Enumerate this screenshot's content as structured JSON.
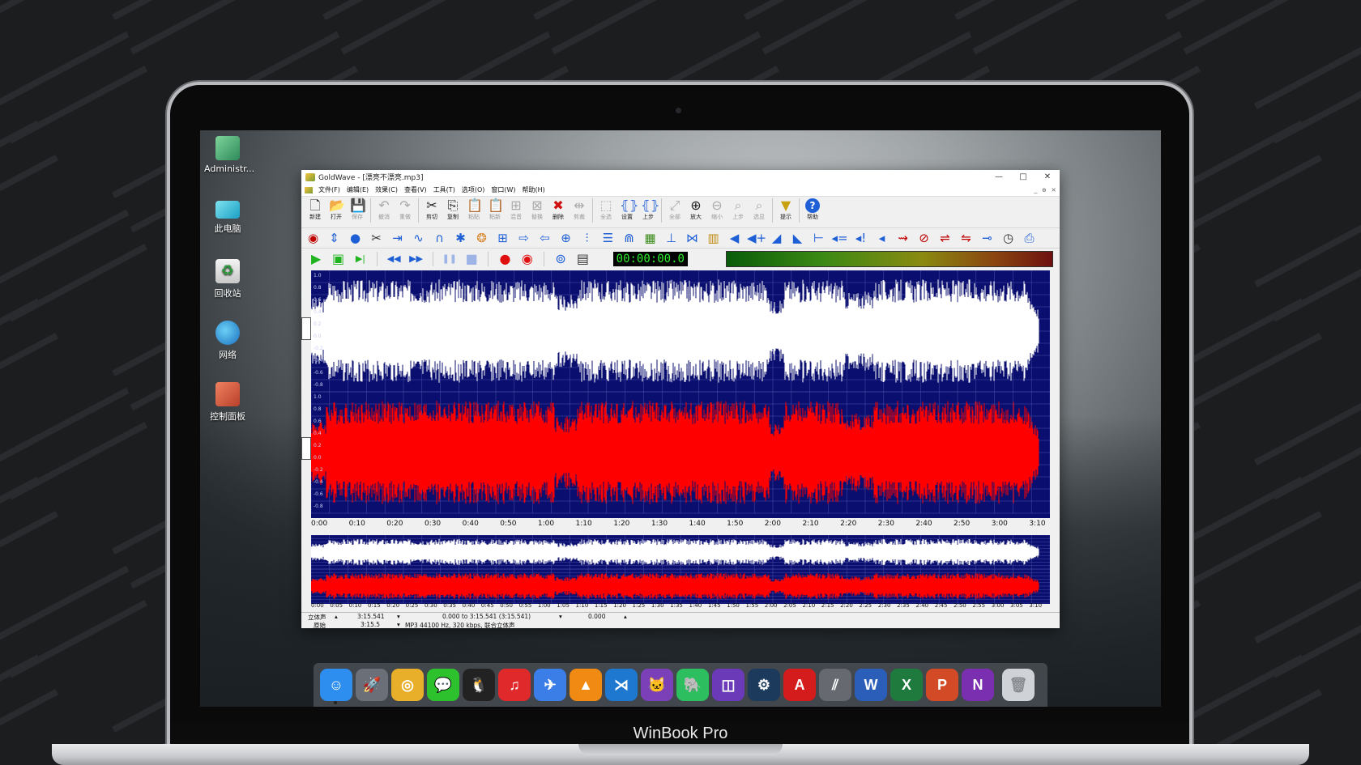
{
  "desktop": {
    "icons": [
      {
        "label": "Administr...",
        "icon": "user-folder-icon"
      },
      {
        "label": "此电脑",
        "icon": "computer-icon"
      },
      {
        "label": "回收站",
        "icon": "recycle-bin-icon"
      },
      {
        "label": "网络",
        "icon": "network-globe-icon"
      },
      {
        "label": "控制面板",
        "icon": "control-panel-icon"
      }
    ]
  },
  "window": {
    "title": "GoldWave - [漂亮不漂亮.mp3]",
    "controls": {
      "minimize": "—",
      "maximize": "□",
      "close": "✕"
    }
  },
  "menu": {
    "items": [
      "文件(F)",
      "编辑(E)",
      "效果(C)",
      "查看(V)",
      "工具(T)",
      "选项(O)",
      "窗口(W)",
      "帮助(H)"
    ],
    "mdi": [
      "_",
      "ɵ",
      "×"
    ]
  },
  "toolbar": {
    "buttons": [
      {
        "label": "新建",
        "icon": "new-file-icon",
        "glyph": "🗋",
        "enabled": true
      },
      {
        "label": "打开",
        "icon": "open-folder-icon",
        "glyph": "📂",
        "enabled": true
      },
      {
        "label": "保存",
        "icon": "save-icon",
        "glyph": "💾",
        "enabled": false
      },
      {
        "label": "撤消",
        "icon": "undo-icon",
        "glyph": "↶",
        "enabled": false
      },
      {
        "label": "重做",
        "icon": "redo-icon",
        "glyph": "↷",
        "enabled": false
      },
      {
        "label": "剪切",
        "icon": "cut-icon",
        "glyph": "✂",
        "enabled": true
      },
      {
        "label": "复制",
        "icon": "copy-icon",
        "glyph": "⎘",
        "enabled": true
      },
      {
        "label": "粘贴",
        "icon": "paste-icon",
        "glyph": "📋",
        "enabled": false
      },
      {
        "label": "粘新",
        "icon": "paste-new-icon",
        "glyph": "📋",
        "enabled": false
      },
      {
        "label": "混音",
        "icon": "mix-icon",
        "glyph": "⊞",
        "enabled": false
      },
      {
        "label": "替换",
        "icon": "replace-icon",
        "glyph": "⊠",
        "enabled": false
      },
      {
        "label": "删除",
        "icon": "delete-icon",
        "glyph": "✖",
        "enabled": true
      },
      {
        "label": "剪裁",
        "icon": "trim-icon",
        "glyph": "⇹",
        "enabled": false
      },
      {
        "label": "全选",
        "icon": "select-all-icon",
        "glyph": "⬚",
        "enabled": false
      },
      {
        "label": "设置",
        "icon": "set-icon",
        "glyph": "⦃⦄",
        "enabled": true
      },
      {
        "label": "上步",
        "icon": "previous-icon",
        "glyph": "⦃⦄",
        "enabled": true
      },
      {
        "label": "全部",
        "icon": "view-all-icon",
        "glyph": "⤢",
        "enabled": false
      },
      {
        "label": "放大",
        "icon": "zoom-in-icon",
        "glyph": "⊕",
        "enabled": true
      },
      {
        "label": "缩小",
        "icon": "zoom-out-icon",
        "glyph": "⊖",
        "enabled": false
      },
      {
        "label": "上步",
        "icon": "zoom-previous-icon",
        "glyph": "⌕",
        "enabled": false
      },
      {
        "label": "选显",
        "icon": "zoom-selection-icon",
        "glyph": "⌕",
        "enabled": false
      },
      {
        "label": "提示",
        "icon": "cue-icon",
        "glyph": "▼",
        "enabled": true
      },
      {
        "label": "帮助",
        "icon": "help-icon",
        "glyph": "?",
        "enabled": true
      }
    ]
  },
  "effects_toolbar": {
    "buttons": [
      {
        "icon": "auto-gain-icon",
        "glyph": "◉",
        "color": "#c00000"
      },
      {
        "icon": "volume-shape-icon",
        "glyph": "⇕",
        "color": "#1f5fd6"
      },
      {
        "icon": "doppler-icon",
        "glyph": "●",
        "color": "#1f5fd6"
      },
      {
        "icon": "noise-reduction-icon",
        "glyph": "✂",
        "color": "#333333"
      },
      {
        "icon": "mechanize-icon",
        "glyph": "⇥",
        "color": "#1f5fd6"
      },
      {
        "icon": "flanger-icon",
        "glyph": "∿",
        "color": "#1f5fd6"
      },
      {
        "icon": "loop-icon",
        "glyph": "∩",
        "color": "#1f5fd6"
      },
      {
        "icon": "pitch-icon",
        "glyph": "✱",
        "color": "#1f5fd6"
      },
      {
        "icon": "resample-icon",
        "glyph": "❂",
        "color": "#d8862a"
      },
      {
        "icon": "playback-rate-icon",
        "glyph": "⊞",
        "color": "#1f5fd6"
      },
      {
        "icon": "forward-icon",
        "glyph": "⇨",
        "color": "#1f5fd6"
      },
      {
        "icon": "reverse-icon",
        "glyph": "⇦",
        "color": "#1f5fd6"
      },
      {
        "icon": "pan-icon",
        "glyph": "⊕",
        "color": "#1f5fd6"
      },
      {
        "icon": "equalizer-icon",
        "glyph": "⫶",
        "color": "#1f5fd6"
      },
      {
        "icon": "filter-icon",
        "glyph": "☰",
        "color": "#1f5fd6"
      },
      {
        "icon": "spectrum-icon",
        "glyph": "⋒",
        "color": "#1f5fd6"
      },
      {
        "icon": "parametric-eq-icon",
        "glyph": "▦",
        "color": "#3a8a1a"
      },
      {
        "icon": "compressor-icon",
        "glyph": "⊥",
        "color": "#1f5fd6"
      },
      {
        "icon": "invert-icon",
        "glyph": "⋈",
        "color": "#1f5fd6"
      },
      {
        "icon": "channel-mixer-icon",
        "glyph": "▥",
        "color": "#c08a10"
      },
      {
        "icon": "mute-icon",
        "glyph": "◀",
        "color": "#1f5fd6"
      },
      {
        "icon": "volume-change-icon",
        "glyph": "◀+",
        "color": "#1f5fd6"
      },
      {
        "icon": "fade-in-icon",
        "glyph": "◢",
        "color": "#1f5fd6"
      },
      {
        "icon": "fade-out-icon",
        "glyph": "◣",
        "color": "#1f5fd6"
      },
      {
        "icon": "match-volume-icon",
        "glyph": "⊢",
        "color": "#1f5fd6"
      },
      {
        "icon": "maximize-volume-icon",
        "glyph": "◂=",
        "color": "#1f5fd6"
      },
      {
        "icon": "echo-icon",
        "glyph": "◂!",
        "color": "#1f5fd6"
      },
      {
        "icon": "silence-icon",
        "glyph": "◂",
        "color": "#1f5fd6"
      },
      {
        "icon": "time-warp-icon",
        "glyph": "⇝",
        "color": "#c00000"
      },
      {
        "icon": "stereo-icon",
        "glyph": "⊘",
        "color": "#c00000"
      },
      {
        "icon": "offset-icon",
        "glyph": "⇌",
        "color": "#c00000"
      },
      {
        "icon": "reverb-icon",
        "glyph": "⇋",
        "color": "#c00000"
      },
      {
        "icon": "marker-icon",
        "glyph": "⊸",
        "color": "#1f5fd6"
      },
      {
        "icon": "timer-icon",
        "glyph": "◷",
        "color": "#333333"
      },
      {
        "icon": "batch-icon",
        "glyph": "⎙",
        "color": "#1f5fd6"
      }
    ]
  },
  "transport": {
    "buttons": [
      {
        "icon": "play-icon",
        "glyph": "▶",
        "color": "#1fb41f"
      },
      {
        "icon": "play-selection-icon",
        "glyph": "▣",
        "color": "#1fb41f"
      },
      {
        "icon": "play-to-end-icon",
        "glyph": "▶|",
        "color": "#1fb41f"
      },
      {
        "icon": "rewind-icon",
        "glyph": "◀◀",
        "color": "#1f5fd6"
      },
      {
        "icon": "fast-forward-icon",
        "glyph": "▶▶",
        "color": "#1f5fd6"
      },
      {
        "icon": "pause-icon",
        "glyph": "❚❚",
        "color": "#9fb4e6"
      },
      {
        "icon": "stop-icon",
        "glyph": "■",
        "color": "#9fb4e6"
      },
      {
        "icon": "record-icon",
        "glyph": "●",
        "color": "#e01010"
      },
      {
        "icon": "record-selection-icon",
        "glyph": "◉",
        "color": "#e01010"
      },
      {
        "icon": "control-properties-icon",
        "glyph": "⊚",
        "color": "#1f5fd6"
      },
      {
        "icon": "device-controls-icon",
        "glyph": "▤",
        "color": "#333333"
      }
    ],
    "time_display": "00:00:00.0"
  },
  "timeline": {
    "labels": [
      "0:00",
      "0:10",
      "0:20",
      "0:30",
      "0:40",
      "0:50",
      "1:00",
      "1:10",
      "1:20",
      "1:30",
      "1:40",
      "1:50",
      "2:00",
      "2:10",
      "2:20",
      "2:30",
      "2:40",
      "2:50",
      "3:00",
      "3:10"
    ],
    "overview_labels": [
      "0:00",
      "0:05",
      "0:10",
      "0:15",
      "0:20",
      "0:25",
      "0:30",
      "0:35",
      "0:40",
      "0:45",
      "0:50",
      "0:55",
      "1:00",
      "1:05",
      "1:10",
      "1:15",
      "1:20",
      "1:25",
      "1:30",
      "1:35",
      "1:40",
      "1:45",
      "1:50",
      "1:55",
      "2:00",
      "2:05",
      "2:10",
      "2:15",
      "2:20",
      "2:25",
      "2:30",
      "2:35",
      "2:40",
      "2:45",
      "2:50",
      "2:55",
      "3:00",
      "3:05",
      "3:10"
    ]
  },
  "scale": {
    "top": [
      "1.0",
      "0.8",
      "0.6",
      "0.4",
      "0.2",
      "0.0",
      "-0.2",
      "-0.4",
      "-0.6",
      "-0.8"
    ],
    "bottom": [
      "1.0",
      "0.8",
      "0.6",
      "0.4",
      "0.2",
      "0.0",
      "-0.2",
      "-0.4",
      "-0.6",
      "-0.8"
    ]
  },
  "status": {
    "channel": "立体声",
    "length": "3:15.541",
    "selection": "0.000 to 3:15.541 (3:15.541)",
    "position": "0.000",
    "row2_label": "原始",
    "row2_length": "3:15.5",
    "format": "MP3 44100 Hz, 320 kbps, 联合立体声"
  },
  "channels": {
    "left_color": "#ffffff",
    "right_color": "#ff0000",
    "background": "#0a0e6e"
  },
  "dock": {
    "apps": [
      {
        "name": "finder-icon",
        "glyph": "☺",
        "color": "#2d8ef0"
      },
      {
        "name": "launchpad-icon",
        "glyph": "🚀",
        "color": "#6a6f78"
      },
      {
        "name": "chrome-icon",
        "glyph": "◎",
        "color": "#e8b02a"
      },
      {
        "name": "wechat-icon",
        "glyph": "💬",
        "color": "#2ec12e"
      },
      {
        "name": "qq-icon",
        "glyph": "🐧",
        "color": "#222222"
      },
      {
        "name": "netease-music-icon",
        "glyph": "♫",
        "color": "#e0292b"
      },
      {
        "name": "feishu-icon",
        "glyph": "✈",
        "color": "#3b7ee8"
      },
      {
        "name": "vlc-icon",
        "glyph": "▲",
        "color": "#f08a12"
      },
      {
        "name": "vscode-icon",
        "glyph": "⋊",
        "color": "#1e78d0"
      },
      {
        "name": "github-icon",
        "glyph": "🐱",
        "color": "#7b3fb8"
      },
      {
        "name": "evernote-icon",
        "glyph": "🐘",
        "color": "#2dbe60"
      },
      {
        "name": "twitch-icon",
        "glyph": "◫",
        "color": "#6a3ab8"
      },
      {
        "name": "steam-icon",
        "glyph": "⚙",
        "color": "#1b3a5c"
      },
      {
        "name": "acrobat-icon",
        "glyph": "A",
        "color": "#d41c1c"
      },
      {
        "name": "parallels-icon",
        "glyph": "⫽",
        "color": "#666a70"
      },
      {
        "name": "word-icon",
        "glyph": "W",
        "color": "#2b5eb8"
      },
      {
        "name": "excel-icon",
        "glyph": "X",
        "color": "#1f7a3e"
      },
      {
        "name": "powerpoint-icon",
        "glyph": "P",
        "color": "#d24a26"
      },
      {
        "name": "onenote-icon",
        "glyph": "N",
        "color": "#7a2eb0"
      },
      {
        "name": "trash-icon",
        "glyph": "🗑",
        "color": "#cfd2d6"
      }
    ]
  },
  "laptop": {
    "brand": "WinBook Pro"
  }
}
